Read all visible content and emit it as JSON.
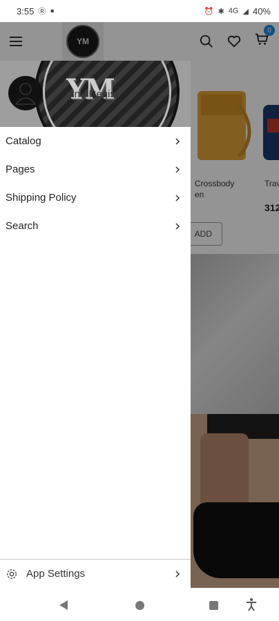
{
  "status": {
    "time": "3:55",
    "network": "4G",
    "battery": "40%"
  },
  "header": {
    "logo_text": "YM",
    "cart_count": "0"
  },
  "background": {
    "products": [
      {
        "name": "Crossbody\nen",
        "price": "",
        "add_label": "ADD"
      },
      {
        "name": "Trav",
        "price": "312"
      }
    ]
  },
  "drawer": {
    "logo_text": "YM",
    "login_label": "gin / Regist",
    "menu": [
      {
        "label": "Catalog"
      },
      {
        "label": "Pages"
      },
      {
        "label": "Shipping Policy"
      },
      {
        "label": "Search"
      }
    ],
    "footer_label": "App Settings"
  },
  "icons": [
    "menu-icon",
    "search-icon",
    "heart-icon",
    "cart-icon",
    "user-icon",
    "chevron-right-icon",
    "gear-icon",
    "back-icon",
    "home-icon",
    "recents-icon",
    "accessibility-icon"
  ]
}
